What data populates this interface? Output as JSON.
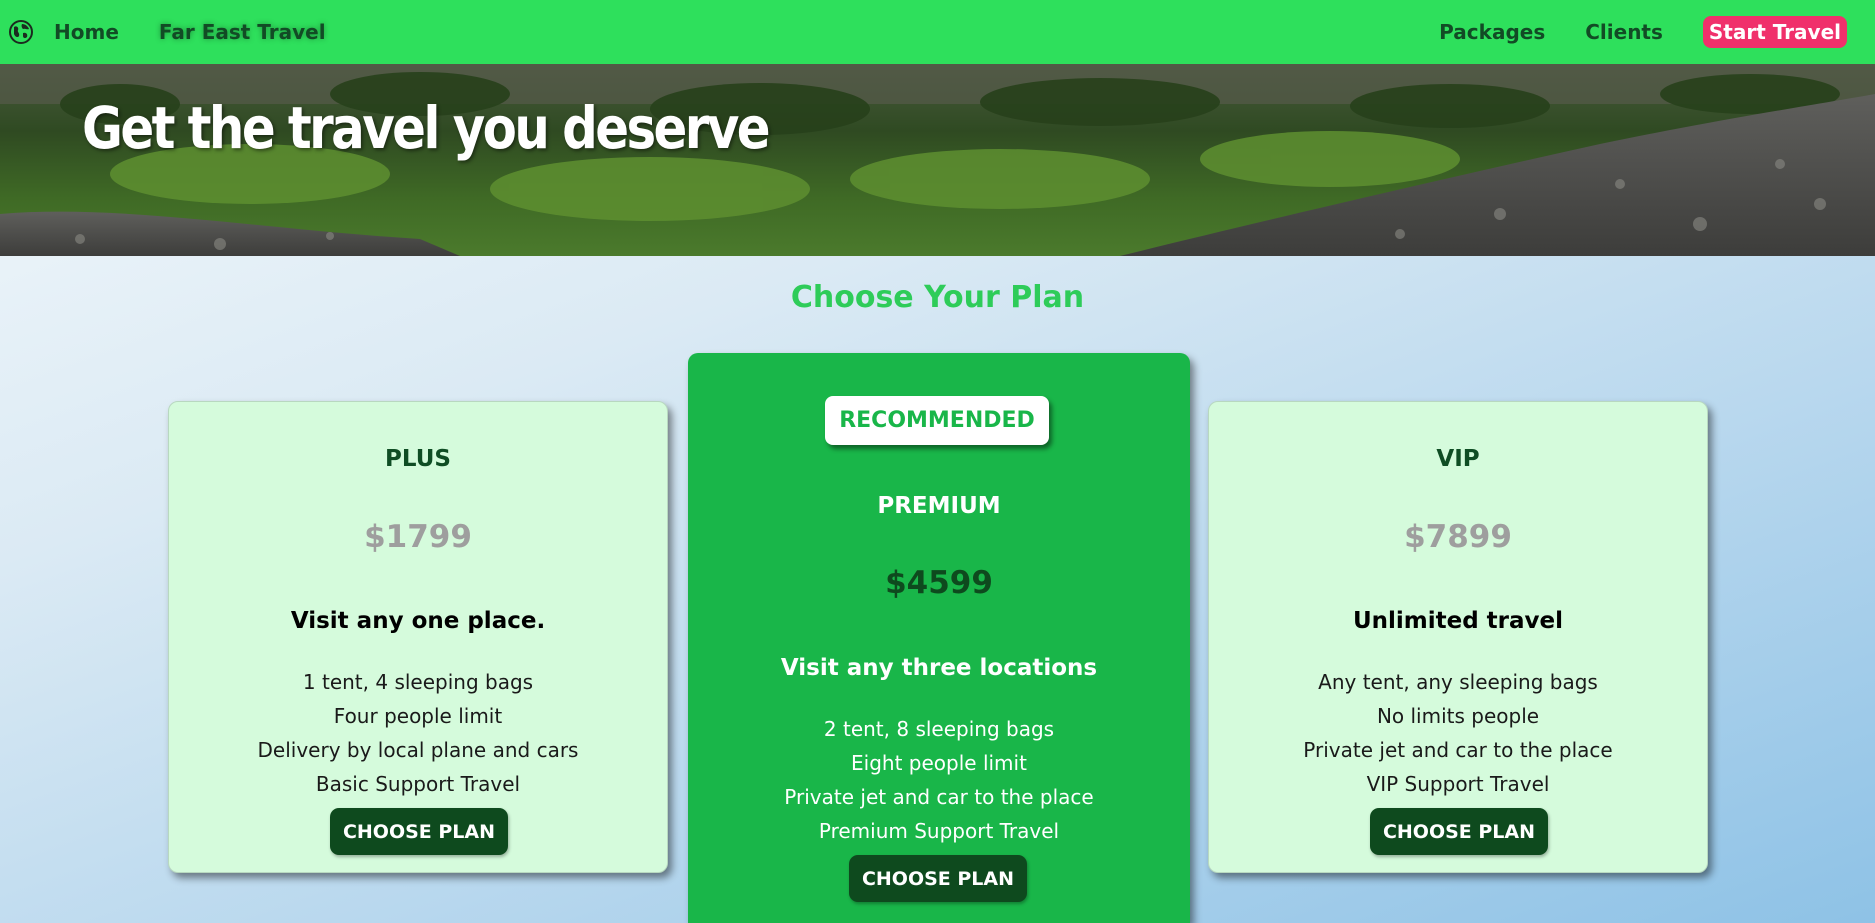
{
  "navbar": {
    "home": "Home",
    "brand": "Far East Travel",
    "links": [
      "Packages",
      "Clients"
    ],
    "cta": "Start Travel",
    "icon": "globe-icon",
    "background": "#2ee05c",
    "cta_color": "#f0306b"
  },
  "hero": {
    "title": "Get the travel you deserve"
  },
  "section": {
    "title": "Choose Your Plan"
  },
  "plans": [
    {
      "name": "PLUS",
      "price": "$1799",
      "headline": "Visit any one place.",
      "features": [
        "1 tent, 4 sleeping bags",
        "Four people limit",
        "Delivery by local plane and cars",
        "Basic Support Travel"
      ],
      "button": "CHOOSE PLAN"
    },
    {
      "badge": "RECOMMENDED",
      "name": "PREMIUM",
      "price": "$4599",
      "headline": "Visit any three locations",
      "features": [
        "2 tent, 8 sleeping bags",
        "Eight people limit",
        "Private jet and car to the place",
        "Premium Support Travel"
      ],
      "button": "CHOOSE PLAN"
    },
    {
      "name": "VIP",
      "price": "$7899",
      "headline": "Unlimited travel",
      "features": [
        "Any tent, any sleeping bags",
        "No limits people",
        "Private jet and car to the place",
        "VIP Support Travel"
      ],
      "button": "CHOOSE PLAN"
    }
  ],
  "colors": {
    "accent_green": "#2ecc59",
    "premium_card": "#19b649",
    "light_card": "#d5fbdc",
    "button_dark": "#0e4a1e"
  }
}
